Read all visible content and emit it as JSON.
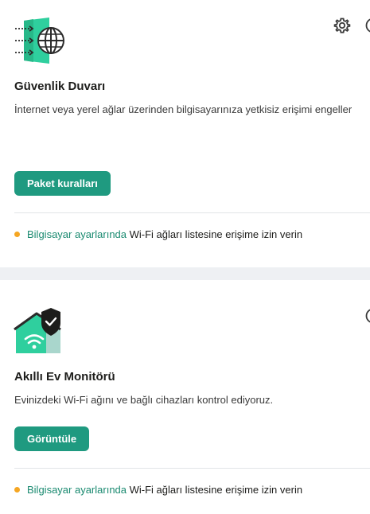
{
  "firewall": {
    "title": "Güvenlik Duvarı",
    "description": "İnternet veya yerel ağlar üzerinden bilgisayarınıza yetkisiz erişimi engeller",
    "button_label": "Paket kuralları",
    "notice_link": "Bilgisayar ayarlarında",
    "notice_text": " Wi-Fi ağları listesine erişime izin verin",
    "icons": [
      "firewall-globe-icon",
      "gear-icon",
      "help-icon"
    ]
  },
  "smart_home": {
    "title": "Akıllı Ev Monitörü",
    "description": "Evinizdeki Wi-Fi ağını ve bağlı cihazları kontrol ediyoruz.",
    "button_label": "Görüntüle",
    "notice_link": "Bilgisayar ayarlarında",
    "notice_text": " Wi-Fi ağları listesine erişime izin verin",
    "icons": [
      "smart-home-shield-icon",
      "help-icon"
    ]
  },
  "colors": {
    "accent": "#1f9a80",
    "link": "#1a8a70",
    "warning_dot": "#f5a623",
    "band": "#eef0f3"
  }
}
